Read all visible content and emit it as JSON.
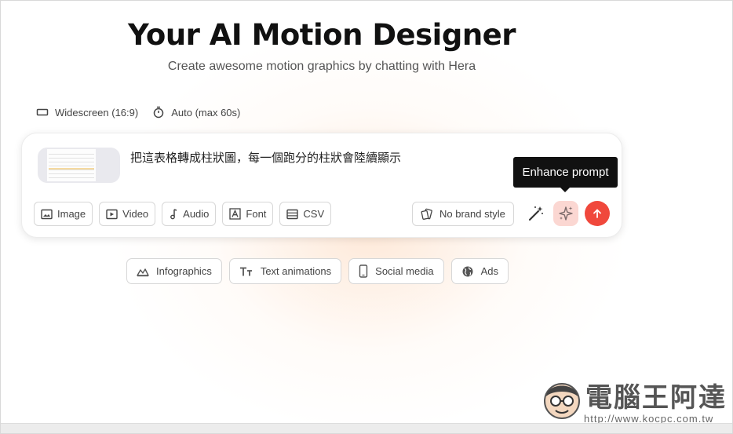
{
  "header": {
    "title": "Your AI Motion Designer",
    "subtitle": "Create awesome motion graphics by chatting with Hera"
  },
  "settings": {
    "aspect_icon": "rectangle-icon",
    "aspect_label": "Widescreen (16:9)",
    "duration_icon": "stopwatch-icon",
    "duration_label": "Auto (max 60s)"
  },
  "composer": {
    "attachment_icon": "spreadsheet-thumbnail",
    "prompt_text": "把這表格轉成柱狀圖，每一個跑分的柱狀會陸續顯示",
    "media_buttons": [
      {
        "icon": "image-icon",
        "label": "Image"
      },
      {
        "icon": "video-icon",
        "label": "Video"
      },
      {
        "icon": "music-note-icon",
        "label": "Audio"
      },
      {
        "icon": "font-icon",
        "label": "Font"
      },
      {
        "icon": "table-icon",
        "label": "CSV"
      }
    ],
    "brand_icon": "brand-style-icon",
    "brand_label": "No brand style",
    "wand_icon": "magic-wand-icon",
    "enhance_icon": "sparkle-icon",
    "send_icon": "arrow-up-icon",
    "tooltip": "Enhance prompt"
  },
  "suggestions": [
    {
      "icon": "mountain-chart-icon",
      "label": "Infographics"
    },
    {
      "icon": "text-icon",
      "label": "Text animations"
    },
    {
      "icon": "smartphone-icon",
      "label": "Social media"
    },
    {
      "icon": "globe-icon",
      "label": "Ads"
    }
  ],
  "watermark": {
    "text": "電腦王阿達",
    "url": "http://www.kocpc.com.tw"
  },
  "colors": {
    "accent": "#f0483c",
    "enhance_bg": "#fbd7d2",
    "tooltip_bg": "#111111"
  }
}
